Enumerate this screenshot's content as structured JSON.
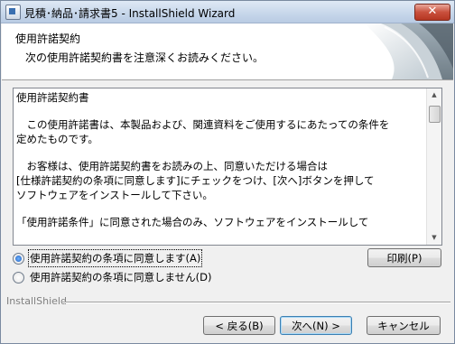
{
  "window": {
    "title": "見積･納品･請求書5 - InstallShield Wizard",
    "close_glyph": "✕"
  },
  "header": {
    "title": "使用許諾契約",
    "subtitle": "次の使用許諾契約書を注意深くお読みください。"
  },
  "license": {
    "lines": [
      "使用許諾契約書",
      "",
      "　この使用許諾書は、本製品および、関連資料をご使用するにあたっての条件を",
      "定めたものです。",
      "",
      "　お客様は、使用許諾契約書をお読みの上、同意いただける場合は",
      "[仕様許諾契約の条項に同意します]にチェックをつけ、[次へ]ボタンを押して",
      "ソフトウェアをインストールして下さい。",
      "",
      "「使用許諾条件」に同意された場合のみ、ソフトウェアをインストールして"
    ],
    "scroll_up_glyph": "▲",
    "scroll_down_glyph": "▼"
  },
  "options": {
    "accept_label": "使用許諾契約の条項に同意します(A)",
    "decline_label": "使用許諾契約の条項に同意しません(D)",
    "selected": "accept"
  },
  "buttons": {
    "print": "印刷(P)",
    "back": "< 戻る(B)",
    "next": "次へ(N) >",
    "cancel": "キャンセル"
  },
  "footer": {
    "brand": "InstallShield"
  },
  "icons": {
    "app": "installer-icon",
    "close": "close-icon",
    "banner": "banner-graphic"
  }
}
